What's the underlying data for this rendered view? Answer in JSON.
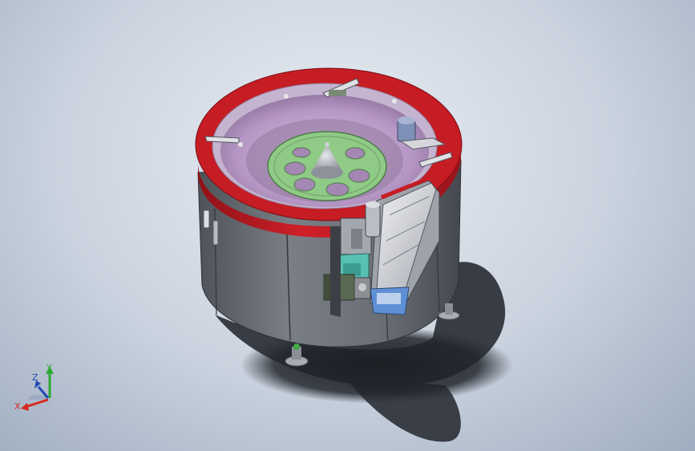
{
  "view": {
    "kind": "cad-3d-model-viewport",
    "subject": "vibratory-bowl-feeder-assembly",
    "colors": {
      "background_center": "#e9edf3",
      "background_edge": "#9fadc0",
      "housing": "#6f737a",
      "rim": "#c61c24",
      "rotary_disc": "#8fca86",
      "bowl_inner": "#b896c8",
      "bracket": "#57c2b4",
      "motor": "#5a6a52",
      "slide_rail": "#d7d9de",
      "base_plate": "#5f8fd4",
      "axis_x": "#d42a1e",
      "axis_y": "#2ea836",
      "axis_z": "#2447b4"
    }
  },
  "triad": {
    "x_label": "X",
    "y_label": "Y",
    "z_label": "Z"
  }
}
